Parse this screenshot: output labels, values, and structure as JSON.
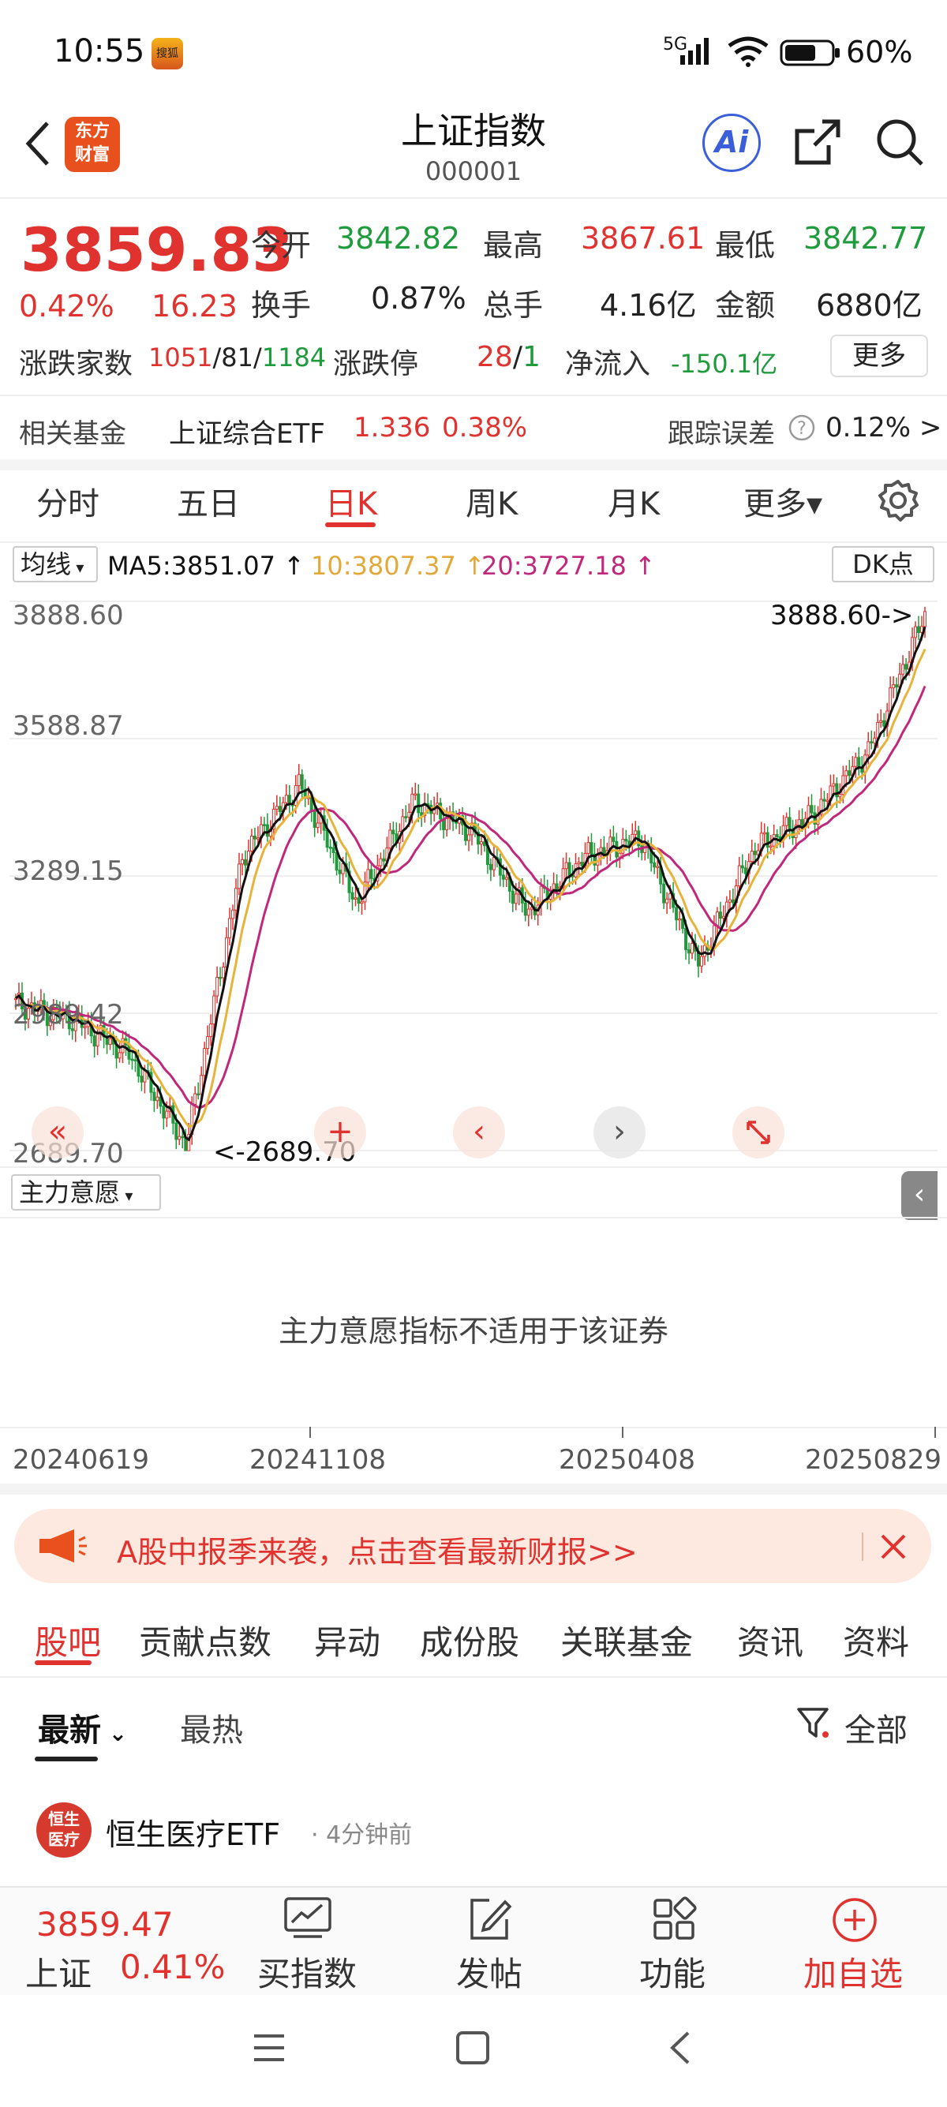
{
  "status_bar": {
    "time": "10:55",
    "app_icon_text": "搜狐",
    "network": "5G",
    "battery": "60%"
  },
  "header": {
    "title": "上证指数",
    "code": "000001",
    "logo_text_line1": "东方",
    "logo_text_line2": "财富",
    "ai_label": "Ai"
  },
  "quote": {
    "price": "3859.83",
    "change_pct": "0.42%",
    "change": "16.23",
    "open_label": "今开",
    "open": "3842.82",
    "high_label": "最高",
    "high": "3867.61",
    "low_label": "最低",
    "low": "3842.77",
    "turnover_label": "换手",
    "turnover": "0.87%",
    "volume_label": "总手",
    "volume": "4.16亿",
    "amount_label": "金额",
    "amount": "6880亿",
    "updown_label": "涨跌家数",
    "up_count": "1051",
    "flat_count": "81",
    "down_count": "1184",
    "limit_label": "涨跌停",
    "limit_up": "28",
    "limit_down": "1",
    "netflow_label": "净流入",
    "netflow": "-150.1亿",
    "more_button": "更多"
  },
  "fund": {
    "label": "相关基金",
    "name": "上证综合ETF",
    "price": "1.336",
    "pct": "0.38%",
    "track_label": "跟踪误差",
    "track_value": "0.12% >"
  },
  "period_tabs": [
    "分时",
    "五日",
    "日K",
    "周K",
    "月K",
    "更多▾"
  ],
  "active_period": "日K",
  "ma": {
    "selector": "均线",
    "ma5": "MA5:3851.07",
    "ma10": "10:3807.37",
    "ma20": "20:3727.18",
    "dk_button": "DK点"
  },
  "chart_data": {
    "type": "candlestick",
    "y_ticks": [
      "3888.60",
      "3588.87",
      "3289.15",
      "2989.42",
      "2689.70"
    ],
    "ylim": [
      2689.7,
      3888.6
    ],
    "max_label": "3888.60->",
    "min_label": "<-2689.70",
    "x_ticks": [
      "20240619",
      "20241108",
      "20250408",
      "20250829"
    ],
    "close_path": [
      [
        "20240619",
        3010
      ],
      [
        "2024-07",
        2975
      ],
      [
        "2024-08",
        2900
      ],
      [
        "2024-09-18",
        2700
      ],
      [
        "2024-09-30",
        3336
      ],
      [
        "2024-10-08",
        3489
      ],
      [
        "2024-10",
        3230
      ],
      [
        "20241108",
        3452
      ],
      [
        "2024-12",
        3390
      ],
      [
        "2025-01",
        3210
      ],
      [
        "2025-02",
        3330
      ],
      [
        "2025-03",
        3372
      ],
      [
        "20250408",
        3096
      ],
      [
        "2025-05",
        3350
      ],
      [
        "2025-06",
        3420
      ],
      [
        "2025-07",
        3560
      ],
      [
        "20250829",
        3859
      ]
    ],
    "series": [
      {
        "name": "MA5",
        "color": "#111111"
      },
      {
        "name": "MA10",
        "color": "#e8b33a"
      },
      {
        "name": "MA20",
        "color": "#c0287c"
      }
    ]
  },
  "sub_indicator": {
    "selector": "主力意愿",
    "message": "主力意愿指标不适用于该证券"
  },
  "banner": {
    "text": "A股中报季来袭，点击查看最新财报>>"
  },
  "content_tabs": [
    "股吧",
    "贡献点数",
    "异动",
    "成份股",
    "关联基金",
    "资讯",
    "资料"
  ],
  "active_content_tab": "股吧",
  "sort_tabs": {
    "latest": "最新",
    "hot": "最热",
    "filter": "全部"
  },
  "post": {
    "author": "恒生医疗ETF",
    "time": "· 4分钟前",
    "avatar_line1": "恒生",
    "avatar_line2": "医疗"
  },
  "bottom_bar": {
    "index_price": "3859.47",
    "index_name": "上证",
    "index_pct": "0.41%",
    "buy": "买指数",
    "post": "发帖",
    "func": "功能",
    "add": "加自选"
  }
}
